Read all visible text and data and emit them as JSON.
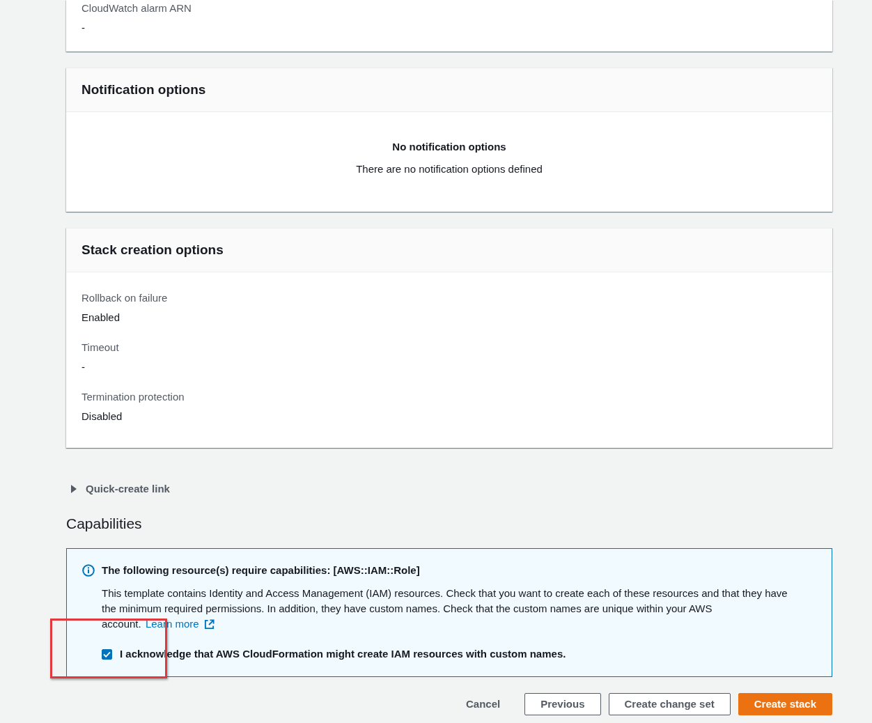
{
  "upper_panel": {
    "fields": [
      {
        "label": "CloudWatch alarm ARN",
        "value": "-"
      }
    ]
  },
  "notification_options": {
    "title": "Notification options",
    "empty_title": "No notification options",
    "empty_text": "There are no notification options defined"
  },
  "stack_creation_options": {
    "title": "Stack creation options",
    "fields": [
      {
        "label": "Rollback on failure",
        "value": "Enabled"
      },
      {
        "label": "Timeout",
        "value": "-"
      },
      {
        "label": "Termination protection",
        "value": "Disabled"
      }
    ]
  },
  "quick_create_link": {
    "label": "Quick-create link",
    "expanded": false
  },
  "capabilities": {
    "heading": "Capabilities",
    "alert": {
      "title": "The following resource(s) require capabilities: [AWS::IAM::Role]",
      "body": "This template contains Identity and Access Management (IAM) resources. Check that you want to create each of these resources and that they have the minimum required permissions. In addition, they have custom names. Check that the custom names are unique within your AWS account.",
      "link": "Learn more"
    },
    "acknowledgement": {
      "label": "I acknowledge that AWS CloudFormation might create IAM resources with custom names.",
      "checked": true,
      "highlighted": true
    }
  },
  "actions": [
    {
      "label": "Cancel",
      "kind": "link"
    },
    {
      "label": "Previous",
      "kind": "secondary"
    },
    {
      "label": "Create change set",
      "kind": "secondary"
    },
    {
      "label": "Create stack",
      "kind": "primary"
    }
  ]
}
